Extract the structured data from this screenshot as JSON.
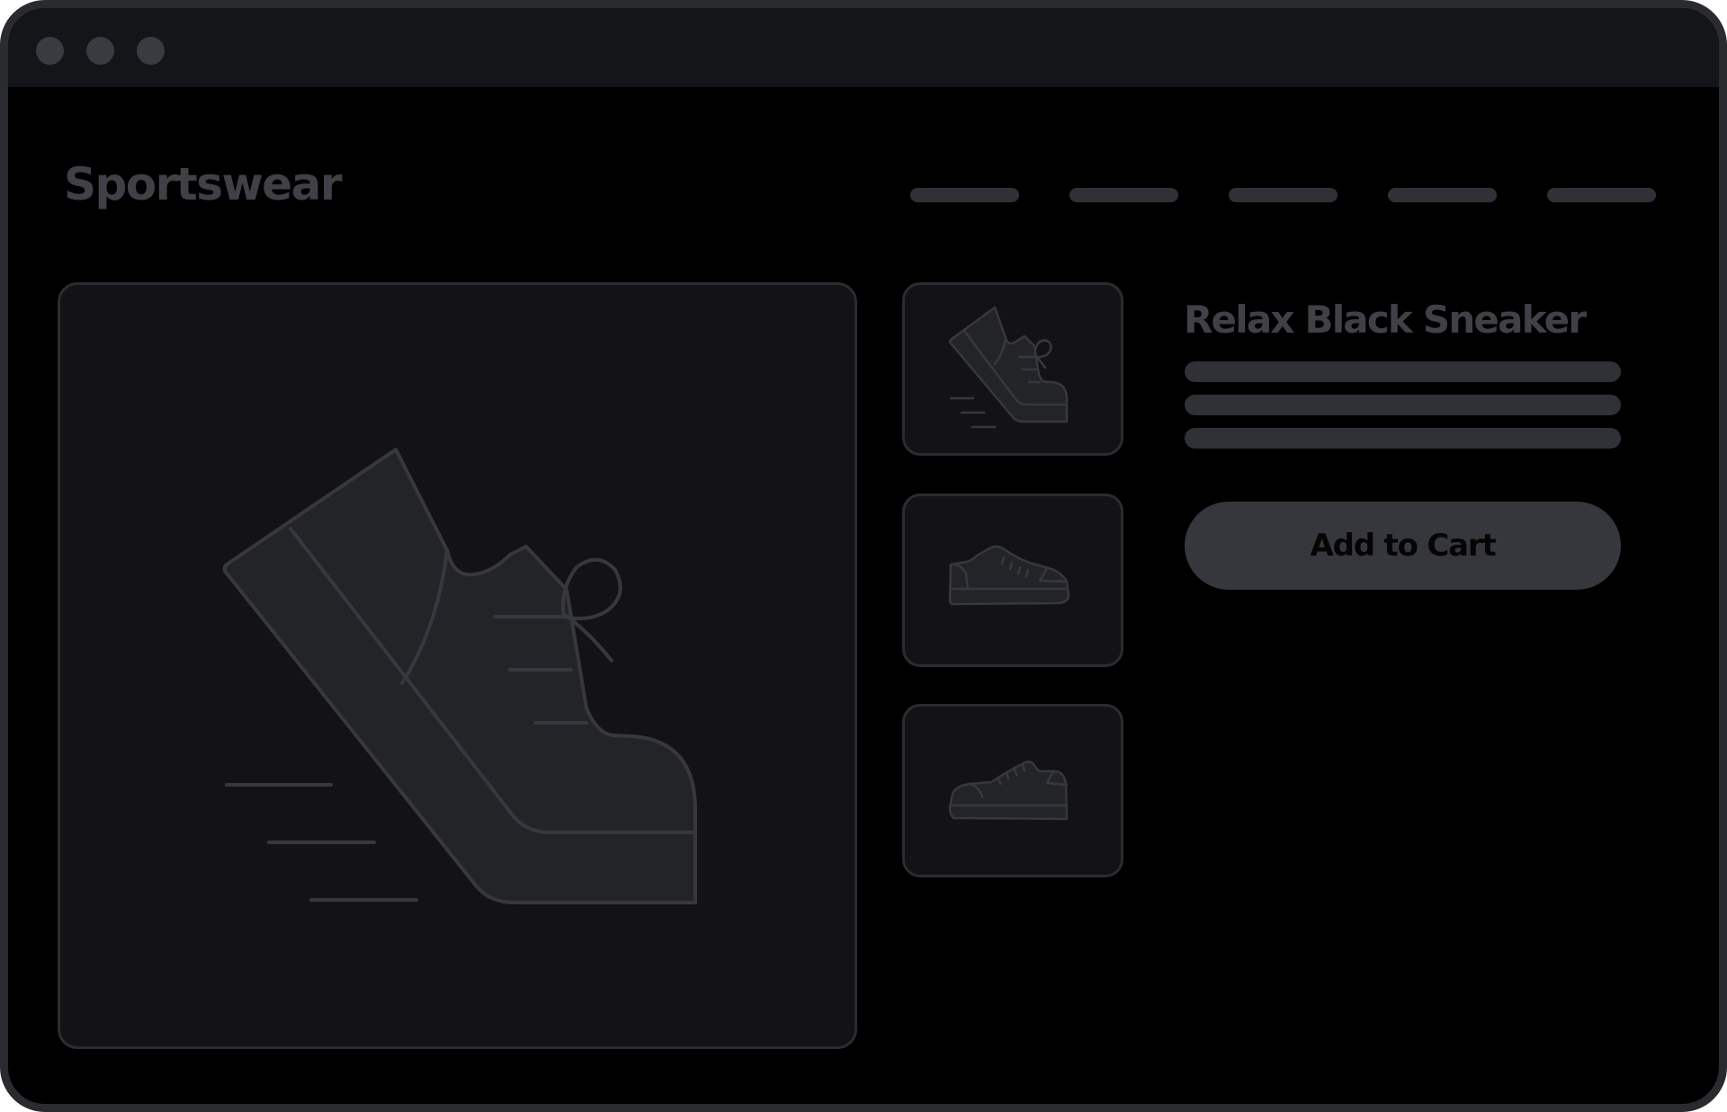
{
  "window": {
    "controls": [
      "close",
      "minimize",
      "maximize"
    ]
  },
  "header": {
    "brand": "Sportswear",
    "nav_item_count": 5
  },
  "product": {
    "title": "Relax Black Sneaker",
    "cart_label": "Add to Cart",
    "hero_image_icon": "running-sneaker-icon",
    "thumbnails": [
      "running-sneaker-icon",
      "sneaker-side-icon",
      "sneaker-side-icon"
    ]
  },
  "colors": {
    "background": "#000000",
    "panel": "#131316",
    "frame": "#2a2b2f",
    "muted_text": "#404147",
    "placeholder_bar": "#303136",
    "button": "#36373c",
    "shoe_fill": "#232428",
    "shoe_stroke": "#37383e"
  }
}
